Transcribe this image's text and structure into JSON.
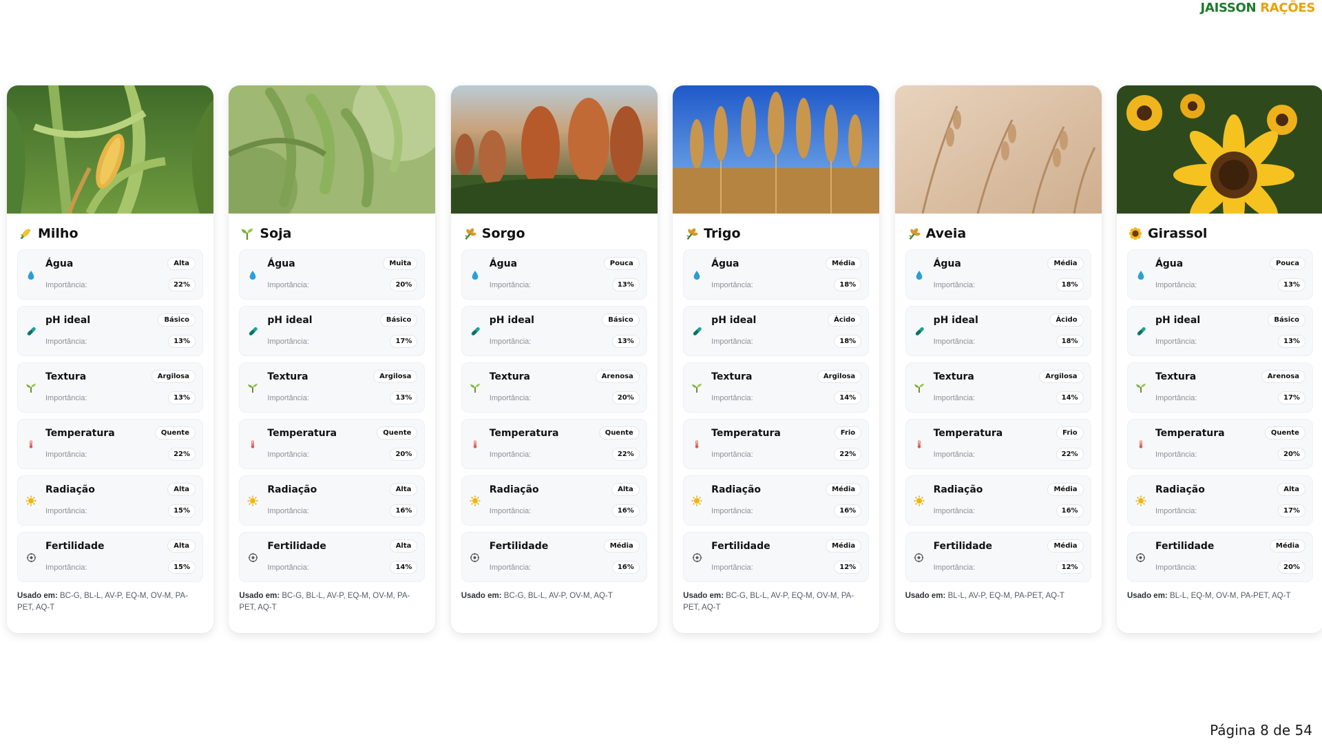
{
  "brand": {
    "part1": "JAISSON",
    "part2": "RAÇÕES"
  },
  "footer": {
    "page_label": "Página 8 de 54"
  },
  "factor_sub_label": "Importância:",
  "used_label": "Usado em:",
  "colors": {
    "brand_green": "#1b7a2b",
    "brand_gold": "#e8a200",
    "water": "#2a9fd6",
    "ph": "#1aa39a",
    "sun": "#f2b705",
    "thermo": "#e0564f"
  },
  "cards": [
    {
      "name": "Milho",
      "icon": "corn-icon",
      "factors": [
        {
          "label": "Água",
          "value": "Alta",
          "importance": "22%"
        },
        {
          "label": "pH ideal",
          "value": "Básico",
          "importance": "13%"
        },
        {
          "label": "Textura",
          "value": "Argilosa",
          "importance": "13%"
        },
        {
          "label": "Temperatura",
          "value": "Quente",
          "importance": "22%"
        },
        {
          "label": "Radiação",
          "value": "Alta",
          "importance": "15%"
        },
        {
          "label": "Fertilidade",
          "value": "Alta",
          "importance": "15%"
        }
      ],
      "used_in": "BC-G, BL-L, AV-P, EQ-M, OV-M, PA-PET, AQ-T"
    },
    {
      "name": "Soja",
      "icon": "seedling-icon",
      "factors": [
        {
          "label": "Água",
          "value": "Muita",
          "importance": "20%"
        },
        {
          "label": "pH ideal",
          "value": "Básico",
          "importance": "17%"
        },
        {
          "label": "Textura",
          "value": "Argilosa",
          "importance": "13%"
        },
        {
          "label": "Temperatura",
          "value": "Quente",
          "importance": "20%"
        },
        {
          "label": "Radiação",
          "value": "Alta",
          "importance": "16%"
        },
        {
          "label": "Fertilidade",
          "value": "Alta",
          "importance": "14%"
        }
      ],
      "used_in": "BC-G, BL-L, AV-P, EQ-M, OV-M, PA-PET, AQ-T"
    },
    {
      "name": "Sorgo",
      "icon": "grain-icon",
      "factors": [
        {
          "label": "Água",
          "value": "Pouca",
          "importance": "13%"
        },
        {
          "label": "pH ideal",
          "value": "Básico",
          "importance": "13%"
        },
        {
          "label": "Textura",
          "value": "Arenosa",
          "importance": "20%"
        },
        {
          "label": "Temperatura",
          "value": "Quente",
          "importance": "22%"
        },
        {
          "label": "Radiação",
          "value": "Alta",
          "importance": "16%"
        },
        {
          "label": "Fertilidade",
          "value": "Média",
          "importance": "16%"
        }
      ],
      "used_in": "BC-G, BL-L, AV-P, OV-M, AQ-T"
    },
    {
      "name": "Trigo",
      "icon": "grain-icon",
      "factors": [
        {
          "label": "Água",
          "value": "Média",
          "importance": "18%"
        },
        {
          "label": "pH ideal",
          "value": "Ácido",
          "importance": "18%"
        },
        {
          "label": "Textura",
          "value": "Argilosa",
          "importance": "14%"
        },
        {
          "label": "Temperatura",
          "value": "Frio",
          "importance": "22%"
        },
        {
          "label": "Radiação",
          "value": "Média",
          "importance": "16%"
        },
        {
          "label": "Fertilidade",
          "value": "Média",
          "importance": "12%"
        }
      ],
      "used_in": "BC-G, BL-L, AV-P, EQ-M, OV-M, PA-PET, AQ-T"
    },
    {
      "name": "Aveia",
      "icon": "grain-icon",
      "factors": [
        {
          "label": "Água",
          "value": "Média",
          "importance": "18%"
        },
        {
          "label": "pH ideal",
          "value": "Ácido",
          "importance": "18%"
        },
        {
          "label": "Textura",
          "value": "Argilosa",
          "importance": "14%"
        },
        {
          "label": "Temperatura",
          "value": "Frio",
          "importance": "22%"
        },
        {
          "label": "Radiação",
          "value": "Média",
          "importance": "16%"
        },
        {
          "label": "Fertilidade",
          "value": "Média",
          "importance": "12%"
        }
      ],
      "used_in": "BL-L, AV-P, EQ-M, PA-PET, AQ-T"
    },
    {
      "name": "Girassol",
      "icon": "sunflower-icon",
      "factors": [
        {
          "label": "Água",
          "value": "Pouca",
          "importance": "13%"
        },
        {
          "label": "pH ideal",
          "value": "Básico",
          "importance": "13%"
        },
        {
          "label": "Textura",
          "value": "Arenosa",
          "importance": "17%"
        },
        {
          "label": "Temperatura",
          "value": "Quente",
          "importance": "20%"
        },
        {
          "label": "Radiação",
          "value": "Alta",
          "importance": "17%"
        },
        {
          "label": "Fertilidade",
          "value": "Média",
          "importance": "20%"
        }
      ],
      "used_in": "BL-L, EQ-M, OV-M, PA-PET, AQ-T"
    }
  ]
}
